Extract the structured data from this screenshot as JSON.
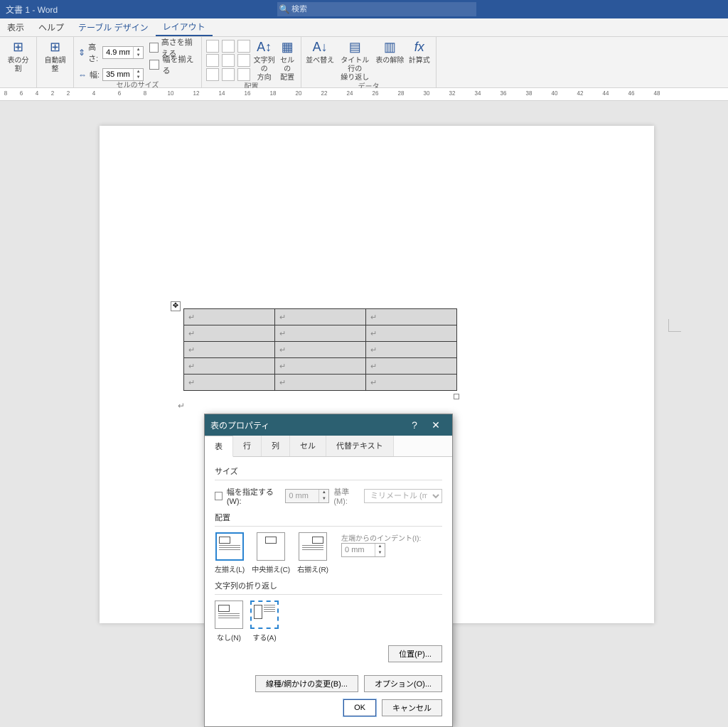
{
  "title": "文書 1  -  Word",
  "search_placeholder": "検索",
  "tabs": {
    "view": "表示",
    "help": "ヘルプ",
    "table_design": "テーブル デザイン",
    "layout": "レイアウト"
  },
  "ribbon": {
    "split": "表の分割",
    "autofit": "自動調整",
    "height_label": "高さ:",
    "height_value": "4.9 mm",
    "width_label": "幅:",
    "width_value": "35 mm",
    "dist_rows": "高さを揃える",
    "dist_cols": "幅を揃える",
    "text_dir": "文字列の\n方向",
    "cell_margins": "セルの\n配置",
    "sort": "並べ替え",
    "repeat_header": "タイトル行の\n繰り返し",
    "convert": "表の解除",
    "formula": "計算式",
    "group_cellsize": "セルのサイズ",
    "group_align": "配置",
    "group_data": "データ"
  },
  "ruler_marks": [
    8,
    6,
    4,
    2,
    2,
    4,
    6,
    8,
    10,
    12,
    14,
    16,
    18,
    20,
    22,
    24,
    26,
    28,
    30,
    32,
    34,
    36,
    38,
    40,
    42,
    44,
    46,
    48
  ],
  "table": {
    "rows": 5,
    "cols": 3
  },
  "dialog": {
    "title": "表のプロパティ",
    "tabs": {
      "table": "表",
      "row": "行",
      "col": "列",
      "cell": "セル",
      "alt": "代替テキスト"
    },
    "size_section": "サイズ",
    "specify_width": "幅を指定する(W):",
    "width_val": "0 mm",
    "basis_label": "基準(M):",
    "basis_val": "ミリメートル (mm)",
    "align_section": "配置",
    "align_left": "左揃え(L)",
    "align_center": "中央揃え(C)",
    "align_right": "右揃え(R)",
    "indent_label": "左端からのインデント(I):",
    "indent_val": "0 mm",
    "wrap_section": "文字列の折り返し",
    "wrap_none": "なし(N)",
    "wrap_around": "する(A)",
    "position_btn": "位置(P)...",
    "borders_btn": "線種/網かけの変更(B)...",
    "options_btn": "オプション(O)...",
    "ok": "OK",
    "cancel": "キャンセル"
  }
}
